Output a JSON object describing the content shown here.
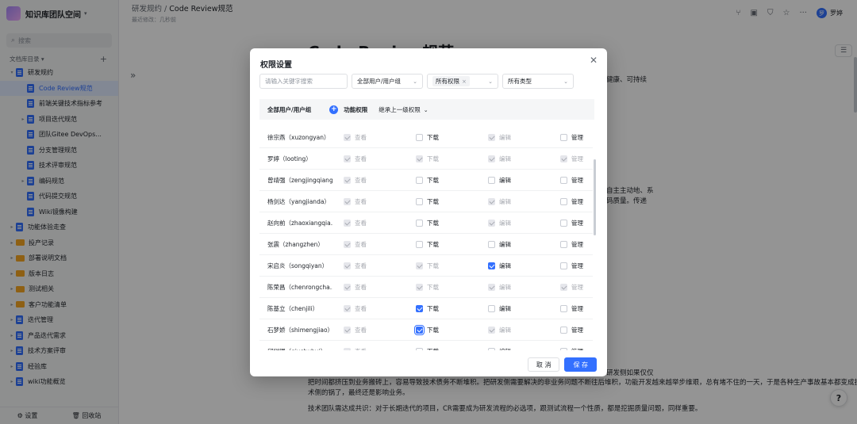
{
  "sidebar": {
    "space_name": "知识库团队空间",
    "search_placeholder": "搜索",
    "tree_header": "文档库目录",
    "items": [
      {
        "label": "研发规约",
        "toggle": "▾",
        "kind": "doc",
        "indent": 0,
        "active": false
      },
      {
        "label": "Code Review规范",
        "toggle": "",
        "kind": "doc",
        "indent": 1,
        "active": true
      },
      {
        "label": "前端关键技术指标参考",
        "toggle": "",
        "kind": "doc",
        "indent": 1,
        "active": false
      },
      {
        "label": "项目迭代规范",
        "toggle": "▸",
        "kind": "doc",
        "indent": 1,
        "active": false
      },
      {
        "label": "团队Gitee DevOps...",
        "toggle": "",
        "kind": "doc",
        "indent": 1,
        "active": false
      },
      {
        "label": "分支管理规范",
        "toggle": "",
        "kind": "doc",
        "indent": 1,
        "active": false
      },
      {
        "label": "技术评审规范",
        "toggle": "",
        "kind": "doc",
        "indent": 1,
        "active": false
      },
      {
        "label": "编码规范",
        "toggle": "▸",
        "kind": "doc",
        "indent": 1,
        "active": false
      },
      {
        "label": "代码提交规范",
        "toggle": "",
        "kind": "doc",
        "indent": 1,
        "active": false
      },
      {
        "label": "Wiki镜像构建",
        "toggle": "",
        "kind": "doc",
        "indent": 1,
        "active": false
      },
      {
        "label": "功能体验走查",
        "toggle": "▸",
        "kind": "doc",
        "indent": 0,
        "active": false
      },
      {
        "label": "投产记录",
        "toggle": "▸",
        "kind": "folder",
        "indent": 0,
        "active": false
      },
      {
        "label": "部署说明文档",
        "toggle": "▸",
        "kind": "folder",
        "indent": 0,
        "active": false
      },
      {
        "label": "版本日志",
        "toggle": "▸",
        "kind": "folder",
        "indent": 0,
        "active": false
      },
      {
        "label": "测试相关",
        "toggle": "▸",
        "kind": "folder",
        "indent": 0,
        "active": false
      },
      {
        "label": "客户功能清单",
        "toggle": "▸",
        "kind": "folder",
        "indent": 0,
        "active": false
      },
      {
        "label": "迭代管理",
        "toggle": "▸",
        "kind": "doc",
        "indent": 0,
        "active": false
      },
      {
        "label": "产品迭代需求",
        "toggle": "▸",
        "kind": "doc",
        "indent": 0,
        "active": false
      },
      {
        "label": "技术方案评审",
        "toggle": "▸",
        "kind": "doc",
        "indent": 0,
        "active": false
      },
      {
        "label": "经验库",
        "toggle": "▸",
        "kind": "doc",
        "indent": 0,
        "active": false
      },
      {
        "label": "wiki功能概览",
        "toggle": "▸",
        "kind": "doc",
        "indent": 0,
        "active": false
      }
    ],
    "settings_label": "设置",
    "recycle_label": "回收站"
  },
  "header": {
    "crumb_parent": "研发规约",
    "crumb_sep": "/",
    "crumb_current": "Code Review规范",
    "last_modified": "最近修改：几秒前",
    "user_initial": "罗",
    "user_name": "罗婷"
  },
  "document": {
    "title": "Code Review规范",
    "frag1": "健康、可持续",
    "frag2": "自主主动地、系",
    "frag3": "码质量。传递",
    "frag4": "研发侧如果仅仅",
    "p1": "把时间都挤压到业务搬砖上，容易导致技术债务不断堆积。把研发侧需要解决的非业务问题不断往后堆积，功能开发越来越举步维艰，总有堵不住的一天，于是各种生产事故基本都变成技术侧的锅了，最终还是影响业务。",
    "p2": "技术团队需达成共识：对于长期迭代的项目，CR需要成为研发流程的必选项，跟测试流程一个性质，都是挖掘质量问题，同样重要。"
  },
  "modal": {
    "title": "权限设置",
    "search_placeholder": "请输入关键字搜索",
    "filter_users": "全部用户/用户组",
    "filter_perm_tag": "所有权限",
    "filter_type": "所有类型",
    "col_users": "全部用户/用户组",
    "col_perm": "功能权限",
    "inherit": "继承上一级权限",
    "perm_labels": [
      "查看",
      "下载",
      "编辑",
      "管理"
    ],
    "rows": [
      {
        "name": "徐宗燕（xuzongyan）",
        "perms": [
          "gray",
          "off",
          "gray",
          "off"
        ]
      },
      {
        "name": "罗婷（looting）",
        "perms": [
          "gray",
          "gray",
          "gray",
          "gray"
        ]
      },
      {
        "name": "曾靖强（zengjingqiang...",
        "perms": [
          "gray",
          "off",
          "off",
          "off"
        ]
      },
      {
        "name": "杨剑达（yangjianda）",
        "perms": [
          "gray",
          "off",
          "gray",
          "off"
        ]
      },
      {
        "name": "赵向前（zhaoxiangqia...",
        "perms": [
          "gray",
          "off",
          "gray",
          "off"
        ]
      },
      {
        "name": "张震（zhangzhen）",
        "perms": [
          "gray",
          "off",
          "off",
          "off"
        ]
      },
      {
        "name": "宋启炎（songqiyan）",
        "perms": [
          "gray",
          "gray",
          "blue",
          "off"
        ]
      },
      {
        "name": "陈荣昌（chenrongcha...",
        "perms": [
          "gray",
          "gray",
          "gray",
          "gray"
        ]
      },
      {
        "name": "陈基立（chenjili）",
        "perms": [
          "gray",
          "blue",
          "off",
          "off"
        ]
      },
      {
        "name": "石梦娇（shimengjiao）",
        "perms": [
          "gray",
          "focus",
          "gray",
          "off"
        ]
      },
      {
        "name": "邱树辉（qiushuhui）",
        "perms": [
          "gray",
          "off",
          "off",
          "off"
        ]
      }
    ],
    "cancel_label": "取 消",
    "save_label": "保 存"
  },
  "icons": [
    "search-icon",
    "plus-icon",
    "share-icon",
    "shield-icon",
    "star-icon",
    "more-icon",
    "close-icon",
    "comment-icon",
    "help-icon",
    "gear-icon",
    "trash-icon"
  ],
  "colors": {
    "accent": "#3370ff",
    "sidebar_bg": "#f5f6f7",
    "overlay": "rgba(0,0,0,0.42)"
  }
}
